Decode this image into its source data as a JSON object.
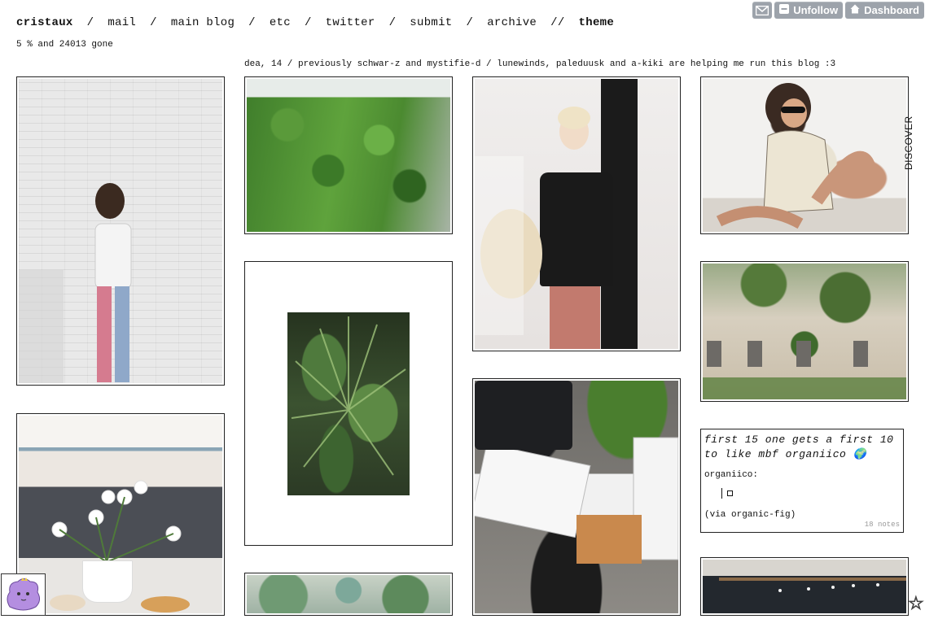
{
  "nav": {
    "blog_name": "cristaux",
    "links": [
      "mail",
      "main blog",
      "etc",
      "twitter",
      "submit",
      "archive"
    ],
    "theme_label": "theme",
    "separator": "/",
    "separator_double": "//"
  },
  "tagline": "5 % and 24013 gone",
  "description": "dea, 14 / previously schwar-z and mystifie-d / lunewinds, paleduusk and a-kiki are helping me run this blog :3",
  "controls": {
    "unfollow_label": "Unfollow",
    "dashboard_label": "Dashboard",
    "mail_icon": "envelope-icon",
    "unfollow_icon": "minus-icon",
    "dashboard_icon": "home-icon"
  },
  "text_post": {
    "title": "first 15 one gets a first 10 to like mbf organiico",
    "source": "organiico:",
    "via": "(via organic-fig)",
    "notes": "18 notes"
  },
  "sidebar": {
    "discover_label": "DISCOVER"
  },
  "colors": {
    "button_bg": "#9da3ab",
    "border": "#222222",
    "notes": "#999999"
  }
}
